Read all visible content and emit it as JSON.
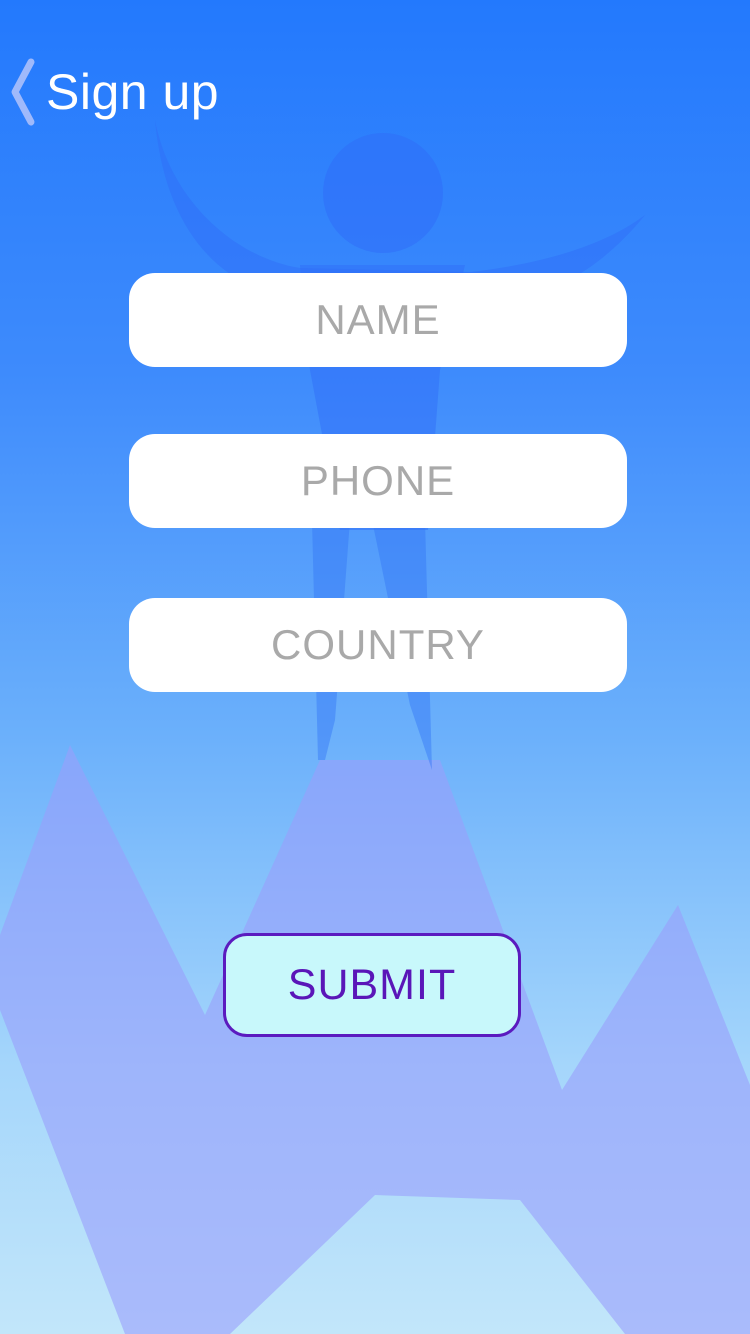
{
  "header": {
    "back_icon": "chevron-left-icon",
    "title": "Sign up"
  },
  "form": {
    "fields": [
      {
        "placeholder": "NAME"
      },
      {
        "placeholder": "PHONE"
      },
      {
        "placeholder": "COUNTRY"
      }
    ],
    "submit_label": "SUBMIT"
  },
  "colors": {
    "background_top": "#2379fd",
    "background_bottom": "#c2e6fa",
    "field_background": "#ffffff",
    "placeholder_text": "#a9a9a9",
    "submit_background": "#c8f8fb",
    "submit_border": "#5b1bbf",
    "submit_text": "#5a16b8"
  }
}
